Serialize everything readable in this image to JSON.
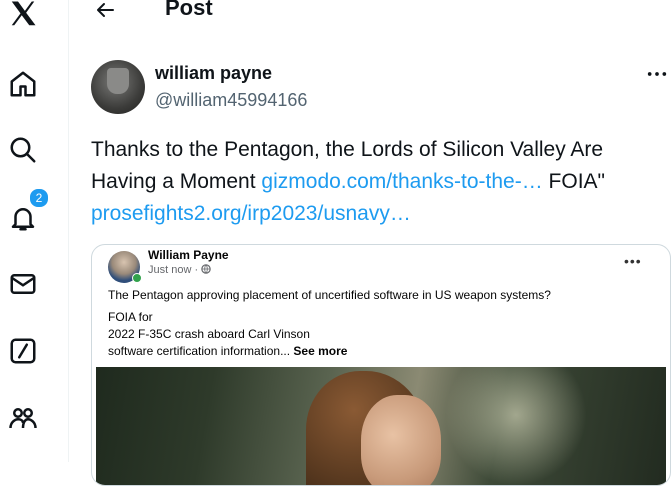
{
  "header": {
    "title": "Post"
  },
  "sidebar": {
    "notifications_badge": "2"
  },
  "tweet": {
    "author": {
      "name": "william payne",
      "handle": "@william45994166"
    },
    "text_part1": "Thanks to the Pentagon, the Lords of Silicon Valley Are",
    "text_part2": "Having a Moment ",
    "link1": "gizmodo.com/thanks-to-the-…",
    "text_part3": "  FOIA\"",
    "link2": "prosefights2.org/irp2023/usnavy…"
  },
  "embedded_card": {
    "name": "William Payne",
    "meta": "Just now · ",
    "line1": "The Pentagon approving placement of uncertified software in US weapon systems?",
    "line2": "FOIA for",
    "line3": "2022 F-35C crash aboard Carl Vinson",
    "line4": "software certification information... ",
    "see_more": "See more"
  },
  "colors": {
    "accent": "#1d9bf0",
    "text": "#0f1419",
    "secondary": "#536471"
  }
}
